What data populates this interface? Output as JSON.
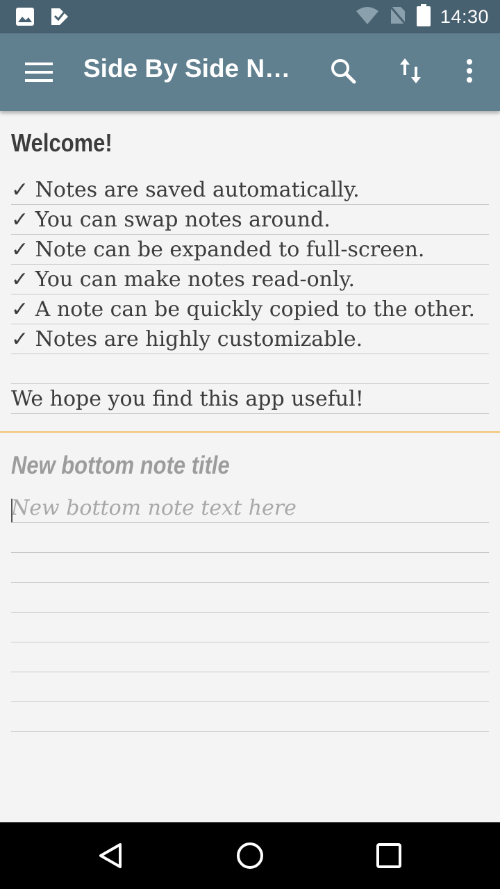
{
  "status_bar": {
    "time": "14:30",
    "icons": [
      "image-icon",
      "check-badge-icon",
      "wifi-icon",
      "no-sim-icon",
      "battery-icon"
    ]
  },
  "app_bar": {
    "title": "Side By Side Notes",
    "actions": [
      "menu-icon",
      "search-icon",
      "swap-icon",
      "more-vert-icon"
    ]
  },
  "top_note": {
    "title": "Welcome!",
    "lines": [
      "✓ Notes are saved automatically.",
      "✓ You can swap notes around.",
      "✓ Note can be expanded to full-screen.",
      "✓ You can make notes read-only.",
      "✓ A note can be quickly copied to the other.",
      "✓ Notes are highly customizable.",
      "",
      "We hope you find this app useful!"
    ]
  },
  "bottom_note": {
    "title_placeholder": "New bottom note title",
    "text_placeholder": "New bottom note text here"
  },
  "nav_bar": {
    "buttons": [
      "back-icon",
      "home-icon",
      "recents-icon"
    ]
  },
  "colors": {
    "status_bar": "#486170",
    "app_bar": "#60808f",
    "background": "#f4f4f4",
    "divider": "#f3c26a"
  }
}
